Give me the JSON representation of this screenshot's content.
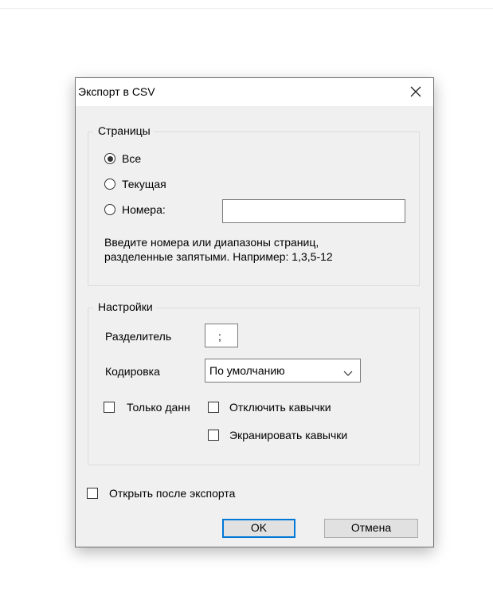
{
  "window": {
    "title": "Экспорт в CSV"
  },
  "pages_group": {
    "legend": "Страницы",
    "options": [
      {
        "label": "Все",
        "checked": true
      },
      {
        "label": "Текущая",
        "checked": false
      },
      {
        "label": "Номера:",
        "checked": false
      }
    ],
    "pages_input_value": "",
    "hint_line1": "Введите номера или диапазоны страниц,",
    "hint_line2": "разделенные запятыми. Например: 1,3,5-12"
  },
  "settings_group": {
    "legend": "Настройки",
    "separator_label": "Разделитель",
    "separator_value": ";",
    "encoding_label": "Кодировка",
    "encoding_value": "По умолчанию",
    "only_data_label": "Только данн",
    "only_data_checked": false,
    "disable_quotes_label": "Отключить кавычки",
    "disable_quotes_checked": false,
    "escape_quotes_label": "Экранировать кавычки",
    "escape_quotes_checked": false
  },
  "open_after_export": {
    "label": "Открыть после экспорта",
    "checked": false
  },
  "buttons": {
    "ok": "OK",
    "cancel": "Отмена"
  },
  "icons": {
    "close": "close-icon",
    "dropdown": "chevron-down-icon"
  },
  "colors": {
    "accent": "#0078d7",
    "dialog_bg": "#f0f0f0"
  }
}
